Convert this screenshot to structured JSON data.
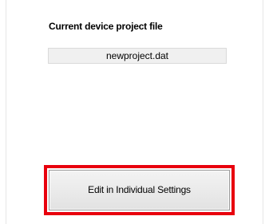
{
  "project_section": {
    "heading": "Current device project file",
    "file_name": "newproject.dat"
  },
  "actions": {
    "edit_button_label": "Edit in Individual Settings"
  },
  "colors": {
    "highlight_border": "#e8000d",
    "field_background": "#f0f0f0",
    "button_background": "#e9e9e9"
  }
}
